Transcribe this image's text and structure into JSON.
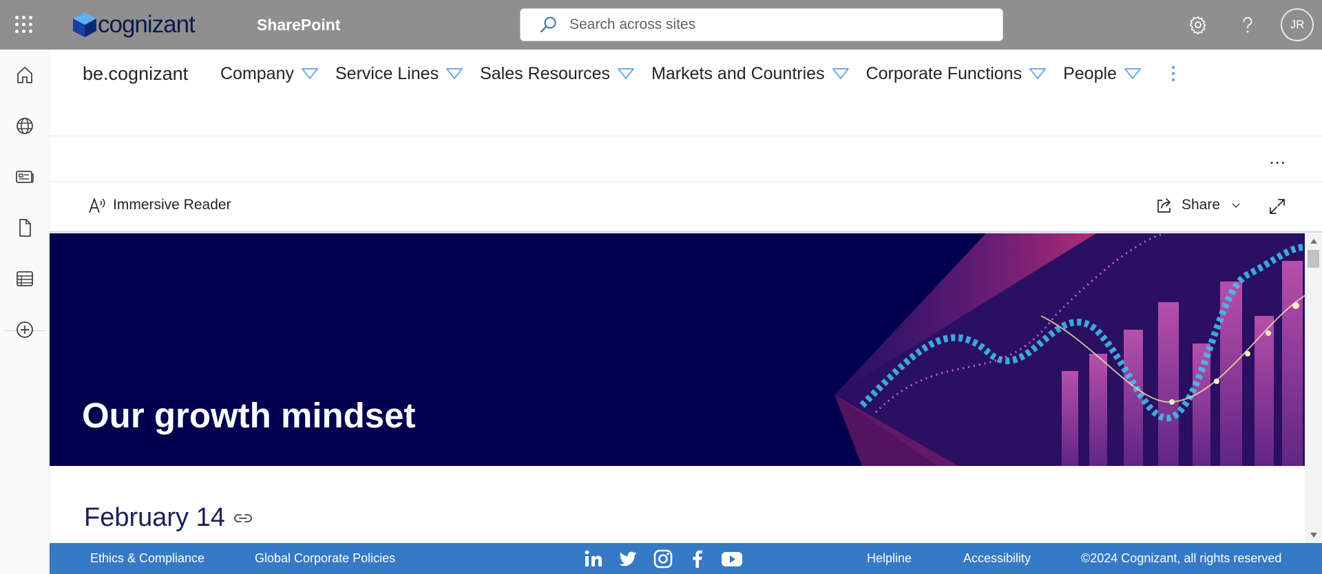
{
  "topbar": {
    "brand_name": "cognizant",
    "app_name": "SharePoint",
    "search_placeholder": "Search across sites",
    "avatar_initials": "JR",
    "colors": {
      "bar": "#8f8f8f",
      "brand_text": "#0b1a4a"
    }
  },
  "leftrail": {
    "icons": [
      "home-icon",
      "globe-icon",
      "news-icon",
      "document-icon",
      "list-icon",
      "add-circle-icon"
    ]
  },
  "site": {
    "title": "be.cognizant",
    "nav": [
      {
        "label": "Company"
      },
      {
        "label": "Service Lines"
      },
      {
        "label": "Sales Resources"
      },
      {
        "label": "Markets and Countries"
      },
      {
        "label": "Corporate Functions"
      },
      {
        "label": "People"
      }
    ]
  },
  "commandbar": {
    "more_label": "...",
    "immersive_reader": "Immersive Reader",
    "share": "Share"
  },
  "hero": {
    "title": "Our growth mindset",
    "background": "#02004f"
  },
  "content": {
    "section_title": "February 14"
  },
  "footer": {
    "links_left": [
      "Ethics & Compliance",
      "Global Corporate Policies"
    ],
    "social": [
      "linkedin-icon",
      "twitter-icon",
      "instagram-icon",
      "facebook-icon",
      "youtube-icon"
    ],
    "links_right": [
      "Helpline",
      "Accessibility"
    ],
    "copyright": "©2024 Cognizant, all rights reserved",
    "color": "#3579c7"
  }
}
